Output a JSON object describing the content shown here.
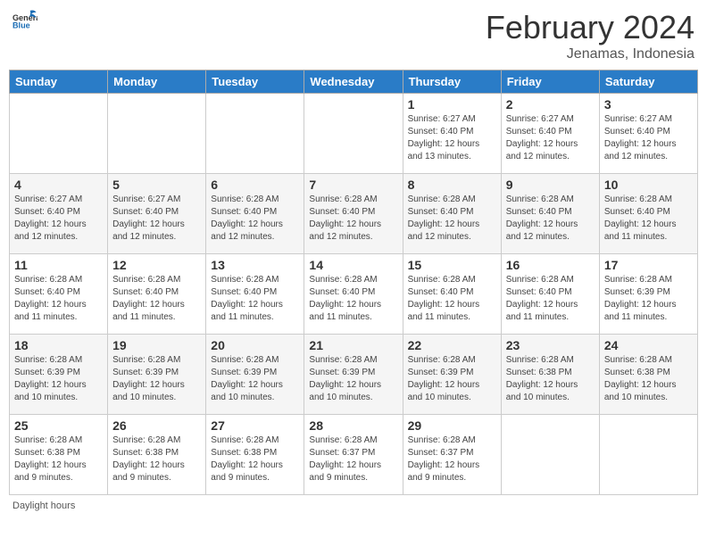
{
  "header": {
    "logo_general": "General",
    "logo_blue": "Blue",
    "month_title": "February 2024",
    "location": "Jenamas, Indonesia"
  },
  "days_of_week": [
    "Sunday",
    "Monday",
    "Tuesday",
    "Wednesday",
    "Thursday",
    "Friday",
    "Saturday"
  ],
  "footer": {
    "daylight_label": "Daylight hours"
  },
  "weeks": [
    [
      {
        "day": "",
        "info": ""
      },
      {
        "day": "",
        "info": ""
      },
      {
        "day": "",
        "info": ""
      },
      {
        "day": "",
        "info": ""
      },
      {
        "day": "1",
        "info": "Sunrise: 6:27 AM\nSunset: 6:40 PM\nDaylight: 12 hours\nand 13 minutes."
      },
      {
        "day": "2",
        "info": "Sunrise: 6:27 AM\nSunset: 6:40 PM\nDaylight: 12 hours\nand 12 minutes."
      },
      {
        "day": "3",
        "info": "Sunrise: 6:27 AM\nSunset: 6:40 PM\nDaylight: 12 hours\nand 12 minutes."
      }
    ],
    [
      {
        "day": "4",
        "info": "Sunrise: 6:27 AM\nSunset: 6:40 PM\nDaylight: 12 hours\nand 12 minutes."
      },
      {
        "day": "5",
        "info": "Sunrise: 6:27 AM\nSunset: 6:40 PM\nDaylight: 12 hours\nand 12 minutes."
      },
      {
        "day": "6",
        "info": "Sunrise: 6:28 AM\nSunset: 6:40 PM\nDaylight: 12 hours\nand 12 minutes."
      },
      {
        "day": "7",
        "info": "Sunrise: 6:28 AM\nSunset: 6:40 PM\nDaylight: 12 hours\nand 12 minutes."
      },
      {
        "day": "8",
        "info": "Sunrise: 6:28 AM\nSunset: 6:40 PM\nDaylight: 12 hours\nand 12 minutes."
      },
      {
        "day": "9",
        "info": "Sunrise: 6:28 AM\nSunset: 6:40 PM\nDaylight: 12 hours\nand 12 minutes."
      },
      {
        "day": "10",
        "info": "Sunrise: 6:28 AM\nSunset: 6:40 PM\nDaylight: 12 hours\nand 11 minutes."
      }
    ],
    [
      {
        "day": "11",
        "info": "Sunrise: 6:28 AM\nSunset: 6:40 PM\nDaylight: 12 hours\nand 11 minutes."
      },
      {
        "day": "12",
        "info": "Sunrise: 6:28 AM\nSunset: 6:40 PM\nDaylight: 12 hours\nand 11 minutes."
      },
      {
        "day": "13",
        "info": "Sunrise: 6:28 AM\nSunset: 6:40 PM\nDaylight: 12 hours\nand 11 minutes."
      },
      {
        "day": "14",
        "info": "Sunrise: 6:28 AM\nSunset: 6:40 PM\nDaylight: 12 hours\nand 11 minutes."
      },
      {
        "day": "15",
        "info": "Sunrise: 6:28 AM\nSunset: 6:40 PM\nDaylight: 12 hours\nand 11 minutes."
      },
      {
        "day": "16",
        "info": "Sunrise: 6:28 AM\nSunset: 6:40 PM\nDaylight: 12 hours\nand 11 minutes."
      },
      {
        "day": "17",
        "info": "Sunrise: 6:28 AM\nSunset: 6:39 PM\nDaylight: 12 hours\nand 11 minutes."
      }
    ],
    [
      {
        "day": "18",
        "info": "Sunrise: 6:28 AM\nSunset: 6:39 PM\nDaylight: 12 hours\nand 10 minutes."
      },
      {
        "day": "19",
        "info": "Sunrise: 6:28 AM\nSunset: 6:39 PM\nDaylight: 12 hours\nand 10 minutes."
      },
      {
        "day": "20",
        "info": "Sunrise: 6:28 AM\nSunset: 6:39 PM\nDaylight: 12 hours\nand 10 minutes."
      },
      {
        "day": "21",
        "info": "Sunrise: 6:28 AM\nSunset: 6:39 PM\nDaylight: 12 hours\nand 10 minutes."
      },
      {
        "day": "22",
        "info": "Sunrise: 6:28 AM\nSunset: 6:39 PM\nDaylight: 12 hours\nand 10 minutes."
      },
      {
        "day": "23",
        "info": "Sunrise: 6:28 AM\nSunset: 6:38 PM\nDaylight: 12 hours\nand 10 minutes."
      },
      {
        "day": "24",
        "info": "Sunrise: 6:28 AM\nSunset: 6:38 PM\nDaylight: 12 hours\nand 10 minutes."
      }
    ],
    [
      {
        "day": "25",
        "info": "Sunrise: 6:28 AM\nSunset: 6:38 PM\nDaylight: 12 hours\nand 9 minutes."
      },
      {
        "day": "26",
        "info": "Sunrise: 6:28 AM\nSunset: 6:38 PM\nDaylight: 12 hours\nand 9 minutes."
      },
      {
        "day": "27",
        "info": "Sunrise: 6:28 AM\nSunset: 6:38 PM\nDaylight: 12 hours\nand 9 minutes."
      },
      {
        "day": "28",
        "info": "Sunrise: 6:28 AM\nSunset: 6:37 PM\nDaylight: 12 hours\nand 9 minutes."
      },
      {
        "day": "29",
        "info": "Sunrise: 6:28 AM\nSunset: 6:37 PM\nDaylight: 12 hours\nand 9 minutes."
      },
      {
        "day": "",
        "info": ""
      },
      {
        "day": "",
        "info": ""
      }
    ]
  ]
}
